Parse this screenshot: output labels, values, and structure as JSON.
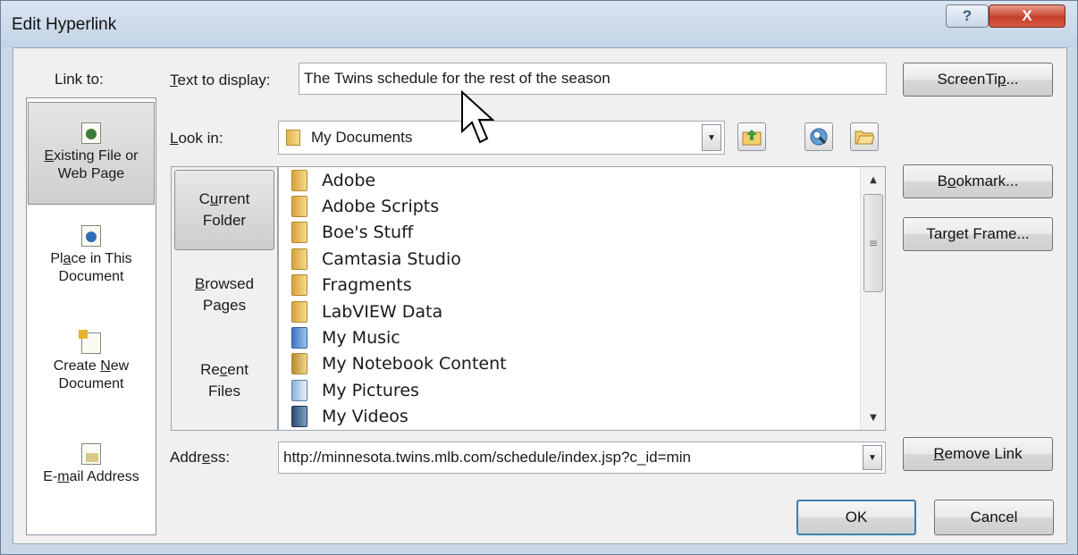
{
  "window": {
    "title": "Edit Hyperlink",
    "help_glyph": "?",
    "close_glyph": "X"
  },
  "link_to": {
    "label": "Link to:",
    "items": [
      {
        "line1_pre": "",
        "line1_u": "E",
        "line1_post": "xisting File or",
        "line2": "Web Page",
        "icon": "existing-file-icon",
        "selected": true
      },
      {
        "line1_pre": "Pl",
        "line1_u": "a",
        "line1_post": "ce in This",
        "line2": "Document",
        "icon": "place-in-document-icon",
        "selected": false
      },
      {
        "line1_pre": "Create ",
        "line1_u": "N",
        "line1_post": "ew",
        "line2": "Document",
        "icon": "new-document-icon",
        "selected": false
      },
      {
        "line1_pre": "E-",
        "line1_u": "m",
        "line1_post": "ail Address",
        "line2": "",
        "icon": "email-address-icon",
        "selected": false
      }
    ]
  },
  "text_to_display": {
    "label_u": "T",
    "label_rest": "ext to display:",
    "value": "The Twins schedule for the rest of the season"
  },
  "screentip": {
    "pre": "ScreenTi",
    "u": "p",
    "post": "..."
  },
  "look_in": {
    "label_u": "L",
    "label_rest": "ook in:",
    "value": "My Documents"
  },
  "browse_tabs": [
    {
      "line1_pre": "C",
      "line1_u": "u",
      "line1_post": "rrent",
      "line2": "Folder",
      "selected": true
    },
    {
      "line1_pre": "",
      "line1_u": "B",
      "line1_post": "rowsed",
      "line2": "Pages",
      "selected": false
    },
    {
      "line1_pre": "Re",
      "line1_u": "c",
      "line1_post": "ent",
      "line2": "Files",
      "selected": false
    }
  ],
  "files": [
    {
      "name": "Adobe",
      "type": "folder"
    },
    {
      "name": "Adobe Scripts",
      "type": "folder"
    },
    {
      "name": "Boe's Stuff",
      "type": "folder"
    },
    {
      "name": "Camtasia Studio",
      "type": "folder"
    },
    {
      "name": "Fragments",
      "type": "folder"
    },
    {
      "name": "LabVIEW Data",
      "type": "folder"
    },
    {
      "name": "My Music",
      "type": "music"
    },
    {
      "name": "My Notebook Content",
      "type": "notebook"
    },
    {
      "name": "My Pictures",
      "type": "pictures"
    },
    {
      "name": "My Videos",
      "type": "videos"
    }
  ],
  "bookmark": {
    "pre": "B",
    "u": "o",
    "post": "okmark..."
  },
  "target_frame": {
    "pre": "Tar",
    "u": "g",
    "post": "et Frame..."
  },
  "address": {
    "label_pre": "Addr",
    "label_u": "e",
    "label_post": "ss:",
    "value": "http://minnesota.twins.mlb.com/schedule/index.jsp?c_id=min"
  },
  "remove_link": {
    "pre": "",
    "u": "R",
    "post": "emove Link"
  },
  "ok_label": "OK",
  "cancel_label": "Cancel",
  "scrollbar": {
    "up": "▲",
    "down": "▼",
    "grip": "≡"
  },
  "colors": {
    "frame": "#c9d7e7",
    "client": "#f0f0f0",
    "close_button": "#c6412a",
    "default_button_border": "#3c7fb1"
  }
}
